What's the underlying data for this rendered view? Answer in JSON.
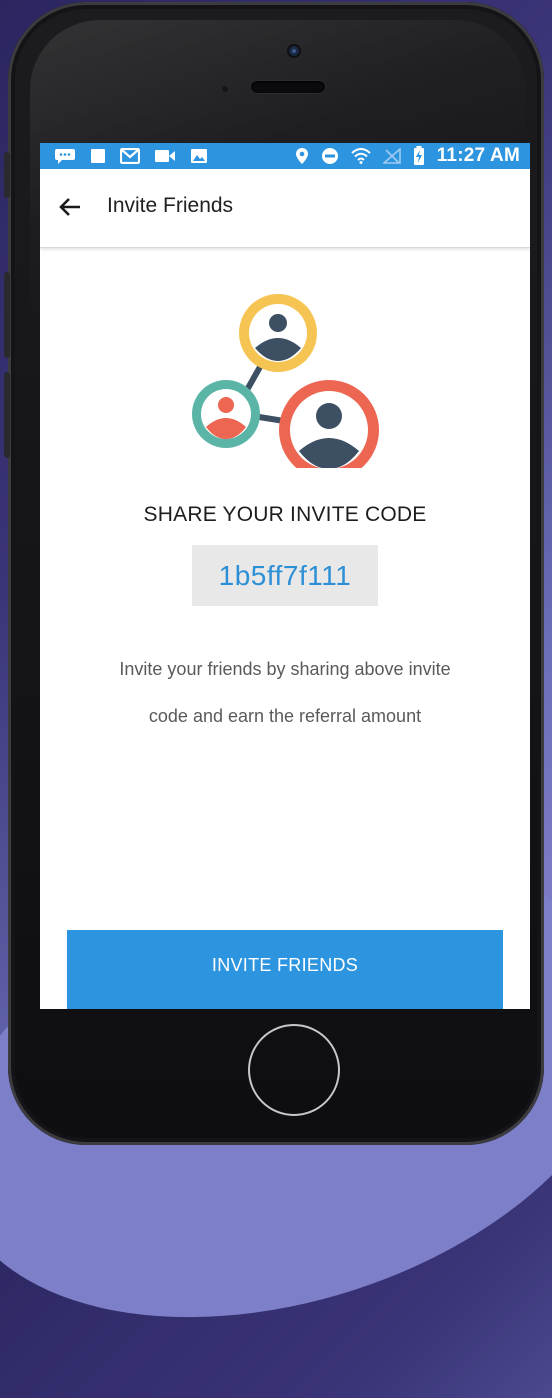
{
  "status_bar": {
    "time": "11:27 AM",
    "icons": [
      "chat-bubble-icon",
      "square-notification-icon",
      "gmail-icon",
      "video-icon",
      "image-icon",
      "location-icon",
      "do-not-disturb-icon",
      "wifi-icon",
      "no-signal-icon",
      "battery-charging-icon"
    ]
  },
  "app_bar": {
    "title": "Invite Friends",
    "back_icon": "arrow-back-icon"
  },
  "content": {
    "illustration": "referral-network-illustration",
    "share_title": "SHARE YOUR INVITE CODE",
    "invite_code": "1b5ff7f111",
    "description_line1": "Invite your friends by sharing above invite",
    "description_line2": "code and earn the referral amount"
  },
  "actions": {
    "invite_button_label": "INVITE FRIENDS"
  },
  "colors": {
    "accent": "#2d95e0",
    "code_text": "#2d8fd6",
    "code_background": "#e8e8e8",
    "avatar_yellow": "#f5c453",
    "avatar_teal": "#5ab5a7",
    "avatar_red": "#ec6652",
    "avatar_dark": "#3d4f62"
  }
}
